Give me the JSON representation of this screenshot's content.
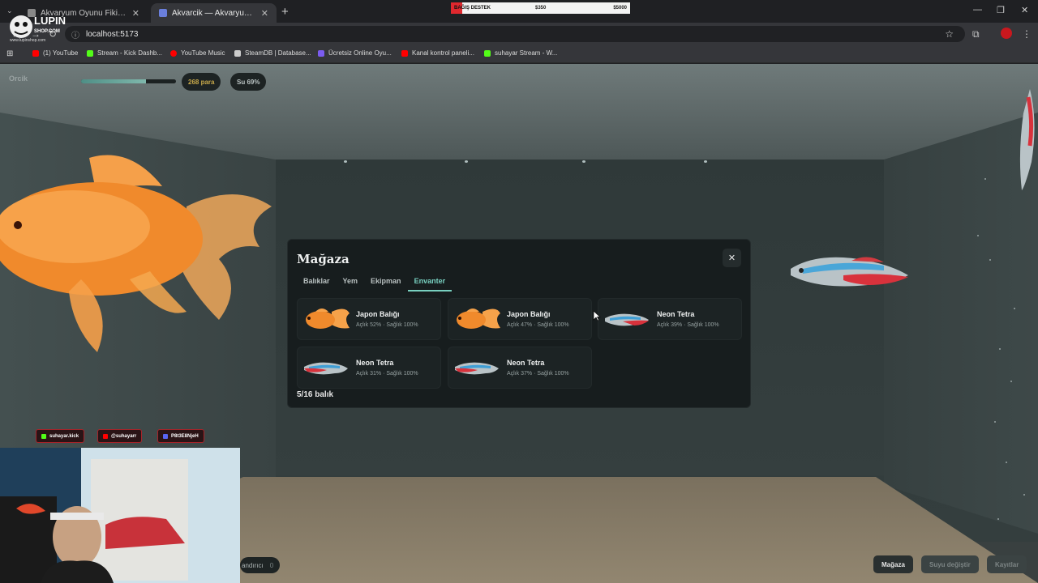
{
  "browser": {
    "tabs": [
      {
        "label": "Akvaryum Oyunu Fikir Geliştirm",
        "active": false
      },
      {
        "label": "Akvarcik — Akvaryum Yönetimi",
        "active": true
      }
    ],
    "url": "localhost:5173",
    "bookmarks": [
      {
        "label": "(1) YouTube",
        "color": "#ff0000"
      },
      {
        "label": "Stream - Kick Dashb...",
        "color": "#53fc18"
      },
      {
        "label": "YouTube Music",
        "color": "#ff0000"
      },
      {
        "label": "SteamDB | Database...",
        "color": "#cccccc"
      },
      {
        "label": "Ücretsiz Online Oyu...",
        "color": "#7b5cf0"
      },
      {
        "label": "Kanal kontrol paneli...",
        "color": "#ff0000"
      },
      {
        "label": "suhayar Stream - W...",
        "color": "#53fc18"
      }
    ]
  },
  "donation": {
    "label": "BAĞIŞ DESTEK",
    "current": "$350",
    "goal": "$5000"
  },
  "logo": {
    "brand": "LUPIN",
    "sub": "SHOP.COM",
    "site": "www.lupinshop.com"
  },
  "hud": {
    "title": "Orcik",
    "progress": 0.68,
    "money": "268 para",
    "water": "Su 69%"
  },
  "modal": {
    "title": "Mağaza",
    "close": "✕",
    "tabs": [
      "Balıklar",
      "Yem",
      "Ekipman",
      "Envanter"
    ],
    "active_tab": "Envanter",
    "items": [
      {
        "name": "Japon Balığı",
        "stats": "Açlık 52% · Sağlık 100%",
        "kind": "goldfish"
      },
      {
        "name": "Japon Balığı",
        "stats": "Açlık 47% · Sağlık 100%",
        "kind": "goldfish"
      },
      {
        "name": "Neon Tetra",
        "stats": "Açlık 39% · Sağlık 100%",
        "kind": "tetra"
      },
      {
        "name": "Neon Tetra",
        "stats": "Açlık 31% · Sağlık 100%",
        "kind": "tetra"
      },
      {
        "name": "Neon Tetra",
        "stats": "Açlık 37% · Sağlık 100%",
        "kind": "tetra"
      }
    ],
    "count": "5/16 balık"
  },
  "socials": [
    {
      "label": "suhayar.kick",
      "color": "#53fc18"
    },
    {
      "label": "@suhayarr",
      "color": "#ff0000"
    },
    {
      "label": "P8t3E8NjeH",
      "color": "#5865f2"
    }
  ],
  "bottom": {
    "feeder_label": "andırıcı",
    "feeder_count": "0",
    "shop": "Mağaza",
    "water_change": "Suyu değiştir",
    "logs": "Kayıtlar"
  }
}
